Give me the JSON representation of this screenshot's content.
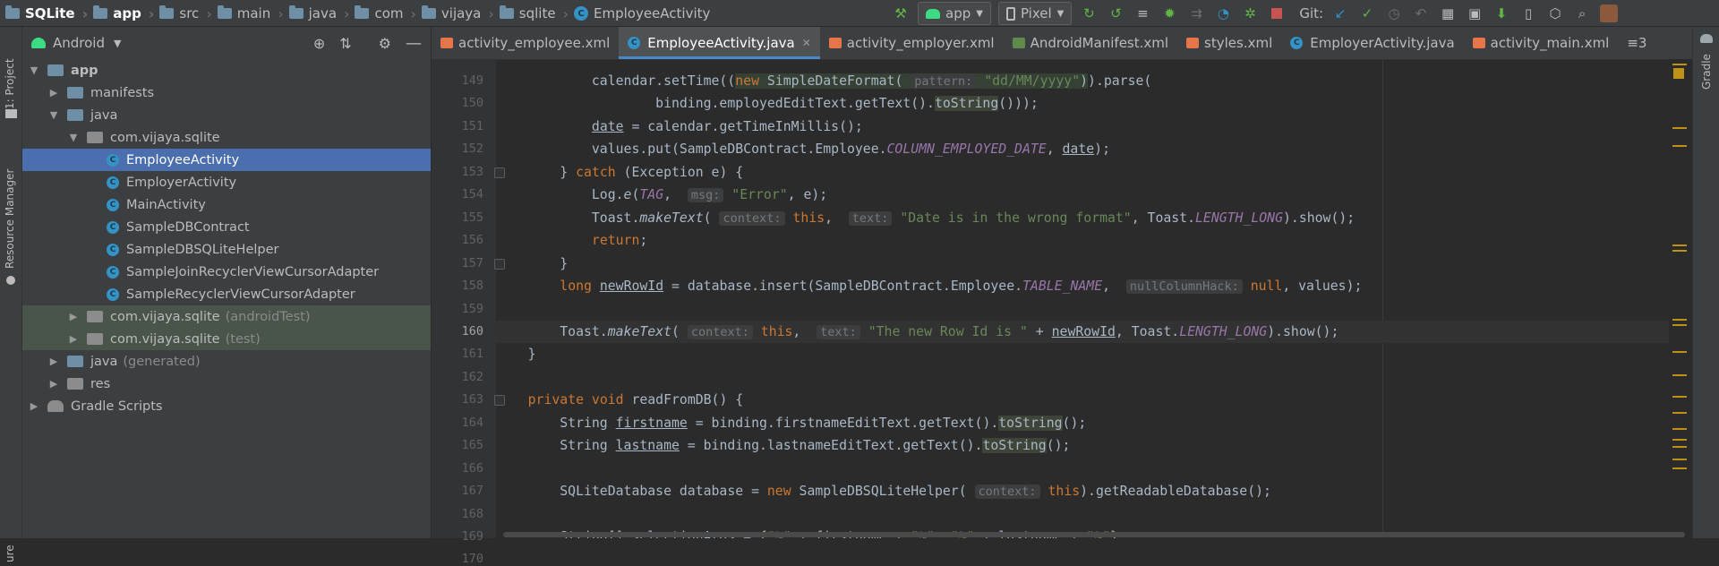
{
  "breadcrumbs": [
    {
      "label": "SQLite",
      "bold": true
    },
    {
      "label": "app",
      "bold": true
    },
    {
      "label": "src"
    },
    {
      "label": "main"
    },
    {
      "label": "java"
    },
    {
      "label": "com"
    },
    {
      "label": "vijaya"
    },
    {
      "label": "sqlite"
    },
    {
      "label": "EmployeeActivity",
      "icon": "C"
    }
  ],
  "toolbar": {
    "run_config": "app",
    "device": "Pixel",
    "git_label": "Git:"
  },
  "left_strip": {
    "project": "1: Project",
    "resource_manager": "Resource Manager",
    "structure": "ure"
  },
  "right_strip": {
    "gradle": "Gradle"
  },
  "project_panel": {
    "view_mode": "Android",
    "tree": [
      {
        "label": "app",
        "depth": 0,
        "open": true,
        "kind": "module",
        "bold": true
      },
      {
        "label": "manifests",
        "depth": 1,
        "open": false,
        "kind": "folder"
      },
      {
        "label": "java",
        "depth": 1,
        "open": true,
        "kind": "folder"
      },
      {
        "label": "com.vijaya.sqlite",
        "depth": 2,
        "open": true,
        "kind": "package"
      },
      {
        "label": "EmployeeActivity",
        "depth": 3,
        "kind": "class",
        "selected": true
      },
      {
        "label": "EmployerActivity",
        "depth": 3,
        "kind": "class"
      },
      {
        "label": "MainActivity",
        "depth": 3,
        "kind": "class"
      },
      {
        "label": "SampleDBContract",
        "depth": 3,
        "kind": "class"
      },
      {
        "label": "SampleDBSQLiteHelper",
        "depth": 3,
        "kind": "class"
      },
      {
        "label": "SampleJoinRecyclerViewCursorAdapter",
        "depth": 3,
        "kind": "class"
      },
      {
        "label": "SampleRecyclerViewCursorAdapter",
        "depth": 3,
        "kind": "class"
      },
      {
        "label": "com.vijaya.sqlite",
        "suffix": "(androidTest)",
        "depth": 2,
        "open": false,
        "kind": "package",
        "test": true
      },
      {
        "label": "com.vijaya.sqlite",
        "suffix": "(test)",
        "depth": 2,
        "open": false,
        "kind": "package",
        "test": true
      },
      {
        "label": "java",
        "suffix": "(generated)",
        "depth": 1,
        "open": false,
        "kind": "folder-gen"
      },
      {
        "label": "res",
        "depth": 1,
        "open": false,
        "kind": "folder-res"
      },
      {
        "label": "Gradle Scripts",
        "depth": 0,
        "open": false,
        "kind": "gradle"
      }
    ]
  },
  "tabs": [
    {
      "label": "activity_employee.xml",
      "type": "xml"
    },
    {
      "label": "EmployeeActivity.java",
      "type": "class",
      "active": true
    },
    {
      "label": "activity_employer.xml",
      "type": "xml"
    },
    {
      "label": "AndroidManifest.xml",
      "type": "manifest"
    },
    {
      "label": "styles.xml",
      "type": "xml"
    },
    {
      "label": "EmployerActivity.java",
      "type": "class"
    },
    {
      "label": "activity_main.xml",
      "type": "xml"
    },
    {
      "label": "≡3",
      "type": "overflow"
    }
  ],
  "code": {
    "current_line": 160,
    "lines": [
      {
        "n": 149,
        "html": "            calendar.setTime((<span class=\"hl\"><span class=\"kw\">new</span> SimpleDateFormat( <span class=\"hint\">pattern:</span> <span class=\"str\">\"dd/MM/yyyy\"</span>)</span>).parse("
      },
      {
        "n": 150,
        "html": "                    binding.employedEditText.getText().<span class=\"rhl\">toString</span>()));"
      },
      {
        "n": 151,
        "html": "            <span class=\"under\">date</span> = calendar.getTimeInMillis();"
      },
      {
        "n": 152,
        "html": "            values.put(SampleDBContract.Employee.<span class=\"fld\">COLUMN_EMPLOYED_DATE</span>, <span class=\"under\">date</span>);"
      },
      {
        "n": 153,
        "html": "        } <span class=\"kw\">catch</span> (Exception e) {"
      },
      {
        "n": 154,
        "html": "            Log.<span class=\"st\">e</span>(<span class=\"fld\">TAG</span>,  <span class=\"hint\">msg:</span> <span class=\"str\">\"Error\"</span>, e);"
      },
      {
        "n": 155,
        "html": "            Toast.<span class=\"st\">makeText</span>( <span class=\"hint\">context:</span> <span class=\"kw\">this</span>,  <span class=\"hint\">text:</span> <span class=\"str\">\"Date is in the wrong format\"</span>, Toast.<span class=\"fld\">LENGTH_LONG</span>).show();"
      },
      {
        "n": 156,
        "html": "            <span class=\"kw\">return</span>;"
      },
      {
        "n": 157,
        "html": "        }"
      },
      {
        "n": 158,
        "html": "        <span class=\"kw\">long</span> <span class=\"under\">newRowId</span> = database.insert(SampleDBContract.Employee.<span class=\"fld\">TABLE_NAME</span>,  <span class=\"hint\">nullColumnHack:</span> <span class=\"kw\">null</span>, values);"
      },
      {
        "n": 159,
        "html": ""
      },
      {
        "n": 160,
        "html": "        Toast.<span class=\"st\">makeText</span>( <span class=\"hint\">context:</span> <span class=\"kw\">this</span>,  <span class=\"hint\">text:</span> <span class=\"str\">\"The new Row Id is \"</span> + <span class=\"under\">newRowId</span>, Toast.<span class=\"fld\">LENGTH_LONG</span>).show();"
      },
      {
        "n": 161,
        "html": "    }"
      },
      {
        "n": 162,
        "html": ""
      },
      {
        "n": 163,
        "html": "    <span class=\"kw\">private void</span> readFromDB() {"
      },
      {
        "n": 164,
        "html": "        String <span class=\"under\">firstname</span> = binding.firstnameEditText.getText().<span class=\"rhl\">toString</span>();"
      },
      {
        "n": 165,
        "html": "        String <span class=\"under\">lastname</span> = binding.lastnameEditText.getText().<span class=\"rhl\">toString</span>();"
      },
      {
        "n": 166,
        "html": ""
      },
      {
        "n": 167,
        "html": "        SQLiteDatabase database = <span class=\"kw\">new</span> SampleDBSQLiteHelper( <span class=\"hint\">context:</span> <span class=\"kw\">this</span>).getReadableDatabase();"
      },
      {
        "n": 168,
        "html": ""
      },
      {
        "n": 169,
        "html": "        String[] selectionArgs = {<span class=\"str\">\"%\"</span> + firstname + <span class=\"str\">\"%\"</span>, <span class=\"str\">\"%\"</span> + lastname + <span class=\"str\">\"%\"</span>};"
      },
      {
        "n": 170,
        "html": ""
      }
    ]
  },
  "fold_lines": [
    153,
    157,
    163
  ],
  "scroll_marks": [
    5,
    76,
    96,
    207,
    213,
    290,
    296,
    326,
    352,
    376,
    394,
    412,
    424,
    432,
    446,
    456
  ],
  "colors": {
    "accent": "#4b6eaf",
    "keyword": "#cc7832",
    "string": "#6a8759",
    "field": "#9876aa"
  }
}
